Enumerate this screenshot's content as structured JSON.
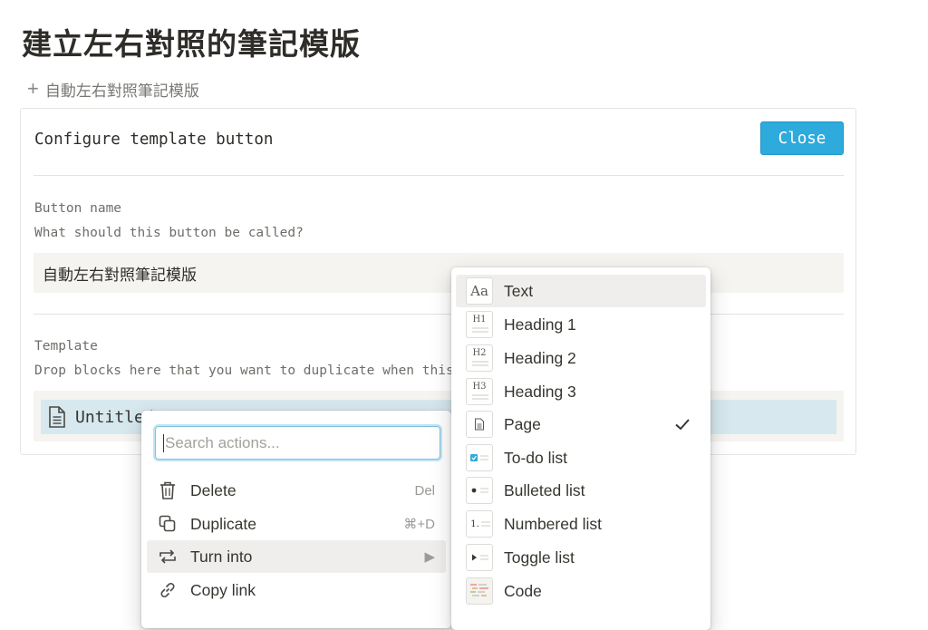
{
  "page": {
    "title": "建立左右對照的筆記模版"
  },
  "template_button": {
    "icon": "plus-icon",
    "plus": "+",
    "label": "自動左右對照筆記模版"
  },
  "config": {
    "title": "Configure template button",
    "close_label": "Close",
    "button_name_label": "Button name",
    "button_name_help": "What should this button be called?",
    "button_name_value": "自動左右對照筆記模版",
    "template_label": "Template",
    "template_help": "Drop blocks here that you want to duplicate when this button is clicked.",
    "block_text": "Untitled",
    "colors": {
      "accent": "#2eaadc",
      "block_highlight": "#d7e9ef",
      "input_bg": "#f5f4f1"
    }
  },
  "actions_menu": {
    "search_placeholder": "Search actions...",
    "items": [
      {
        "label": "Delete",
        "shortcut": "Del",
        "icon": "trash-icon"
      },
      {
        "label": "Duplicate",
        "shortcut": "⌘+D",
        "icon": "duplicate-icon"
      },
      {
        "label": "Turn into",
        "shortcut": "▶",
        "icon": "turn-into-icon",
        "active": true
      },
      {
        "label": "Copy link",
        "shortcut": "",
        "icon": "link-icon"
      }
    ]
  },
  "turn_into_menu": {
    "items": [
      {
        "label": "Text",
        "icon": "text-icon",
        "glyph": "Aa",
        "active": true
      },
      {
        "label": "Heading 1",
        "icon": "heading1-icon",
        "glyph": "H1"
      },
      {
        "label": "Heading 2",
        "icon": "heading2-icon",
        "glyph": "H2"
      },
      {
        "label": "Heading 3",
        "icon": "heading3-icon",
        "glyph": "H3"
      },
      {
        "label": "Page",
        "icon": "page-icon",
        "glyph": "",
        "checked": true
      },
      {
        "label": "To-do list",
        "icon": "todo-icon",
        "glyph": ""
      },
      {
        "label": "Bulleted list",
        "icon": "bullet-icon",
        "glyph": ""
      },
      {
        "label": "Numbered list",
        "icon": "numbered-icon",
        "glyph": "1."
      },
      {
        "label": "Toggle list",
        "icon": "toggle-icon",
        "glyph": ""
      },
      {
        "label": "Code",
        "icon": "code-icon",
        "glyph": ""
      }
    ]
  }
}
